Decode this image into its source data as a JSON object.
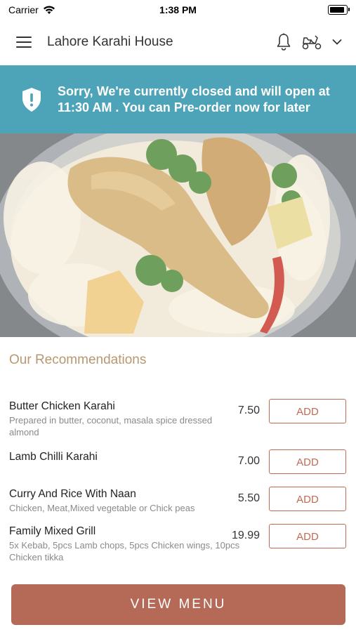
{
  "status_bar": {
    "carrier": "Carrier",
    "time": "1:38 PM"
  },
  "nav": {
    "title": "Lahore Karahi House"
  },
  "banner": {
    "message": "Sorry, We're currently closed and will open at 11:30 AM . You can Pre-order now for later"
  },
  "recommendations": {
    "title": "Our Recommendations",
    "add_label": "ADD",
    "items": [
      {
        "name": "Butter Chicken Karahi",
        "description": "Prepared in butter, coconut, masala spice dressed almond",
        "price": "7.50"
      },
      {
        "name": "Lamb Chilli Karahi",
        "description": "",
        "price": "7.00"
      },
      {
        "name": "Curry And Rice With Naan",
        "description": "Chicken, Meat,Mixed vegetable or Chick peas",
        "price": "5.50"
      },
      {
        "name": "Family Mixed Grill",
        "description": "5x Kebab, 5pcs Lamb chops, 5pcs Chicken wings, 10pcs Chicken tikka",
        "price": "19.99"
      }
    ]
  },
  "footer": {
    "view_menu_label": "VIEW MENU"
  },
  "colors": {
    "banner": "#4da3b8",
    "accent": "#b46a57",
    "section_title": "#b89870"
  },
  "icons": [
    "wifi-icon",
    "battery-icon",
    "menu-icon",
    "bell-icon",
    "scooter-icon",
    "chevron-down-icon",
    "shield-icon"
  ]
}
